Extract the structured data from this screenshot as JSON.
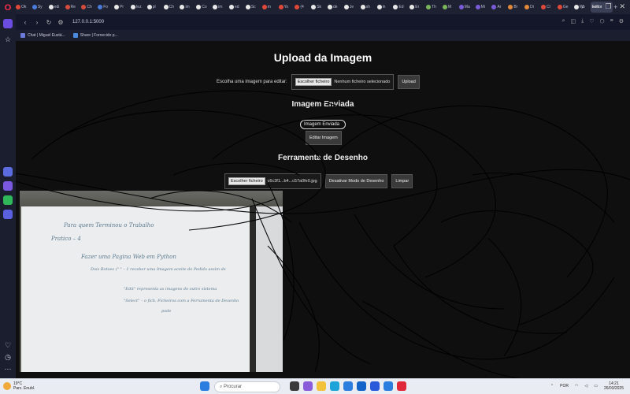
{
  "browser": {
    "tabs": [
      {
        "label": "Ok",
        "color": "#e0483a"
      },
      {
        "label": "Sy",
        "color": "#4a7bd9"
      },
      {
        "label": "edi",
        "color": "#e8e8e8"
      },
      {
        "label": "Re",
        "color": "#d54b3d"
      },
      {
        "label": "Ch",
        "color": "#d54b3d"
      },
      {
        "label": "Fo",
        "color": "#4a7bd9"
      },
      {
        "label": "Pr",
        "color": "#e8e8e8"
      },
      {
        "label": "Iez",
        "color": "#e8e8e8"
      },
      {
        "label": "pl",
        "color": "#e8e8e8"
      },
      {
        "label": "Ch",
        "color": "#e8e8e8"
      },
      {
        "label": "im",
        "color": "#e8e8e8"
      },
      {
        "label": "Co",
        "color": "#e8e8e8"
      },
      {
        "label": "im",
        "color": "#e8e8e8"
      },
      {
        "label": "ed",
        "color": "#e8e8e8"
      },
      {
        "label": "Sc",
        "color": "#e8e8e8"
      },
      {
        "label": "m",
        "color": "#e0483a"
      },
      {
        "label": "Yo",
        "color": "#e0483a"
      },
      {
        "label": "(4",
        "color": "#e0483a"
      },
      {
        "label": "Sk",
        "color": "#e8e8e8"
      },
      {
        "label": "de",
        "color": "#e8e8e8"
      },
      {
        "label": "Je",
        "color": "#e8e8e8"
      },
      {
        "label": "sh",
        "color": "#e8e8e8"
      },
      {
        "label": "in",
        "color": "#e8e8e8"
      },
      {
        "label": "Ed",
        "color": "#e8e8e8"
      },
      {
        "label": "Er",
        "color": "#e8e8e8"
      },
      {
        "label": "Th",
        "color": "#7ab55c"
      },
      {
        "label": "M",
        "color": "#7ab55c"
      },
      {
        "label": "Ma",
        "color": "#7a5cd9"
      },
      {
        "label": "Mi",
        "color": "#7a5cd9"
      },
      {
        "label": "Ar",
        "color": "#7a5cd9"
      },
      {
        "label": "Br",
        "color": "#e08a3a"
      },
      {
        "label": "Di",
        "color": "#e08a3a"
      },
      {
        "label": "Cl",
        "color": "#e0483a"
      },
      {
        "label": "Ge",
        "color": "#e0483a"
      },
      {
        "label": "Wi",
        "color": "#e8e8e8"
      }
    ],
    "active_tab": "Editor",
    "url": "127.0.0.1:5000",
    "bookmarks": [
      {
        "label": "Chat | Miguel Eustá..."
      },
      {
        "label": "Share | Fornecido p..."
      }
    ]
  },
  "page": {
    "title": "Upload da Imagem",
    "upload_label": "Escolha uma imagem para editar:",
    "file_button": "Escolher ficheiro",
    "no_file_text": "Nenhum ficheiro selecionado",
    "upload_button": "Upload",
    "sent_heading": "Imagem Enviada",
    "sent_image_alt": "Imagem Enviada",
    "edit_button": "Editar Imagem",
    "draw_heading": "Ferramenta de Desenho",
    "draw_file_button": "Escolher ficheiro",
    "draw_file_name": "c6c3f1...b4...c57a0fe0.jpg",
    "draw_mode_button": "Desativar Modo de Desenho",
    "clear_button": "Limpar"
  },
  "whiteboard_text": [
    "Para quem Terminou o Trabalho",
    "Pratico – 4",
    "Fazer uma Pagina Web em Python",
    "Dois Botoes (\" \" – 1 receber uma Imagem aceite do Pedido assim de",
    "\"Edit\" representa as imagens do outro sistema",
    "\"Select\" – o fich. Ficheiros com a Ferramenta de Desenho",
    "pode"
  ],
  "taskbar": {
    "temperature": "19°C",
    "weather": "Parc. Enubl.",
    "search_placeholder": "Procurar",
    "language": "POR",
    "time": "14:21",
    "date": "26/03/2025"
  }
}
